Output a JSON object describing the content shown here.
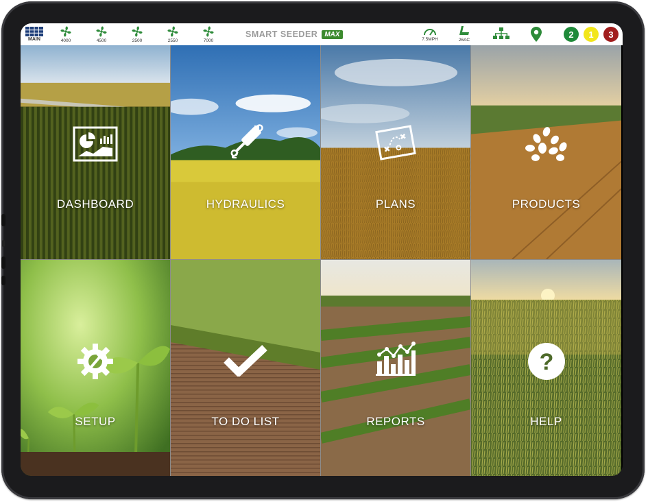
{
  "topbar": {
    "main_label": "MAIN",
    "fans": [
      {
        "icon": "fan-icon",
        "label": "4000"
      },
      {
        "icon": "fan-icon",
        "label": "4500"
      },
      {
        "icon": "fan-icon",
        "label": "2500"
      },
      {
        "icon": "fan-icon",
        "label": "2550"
      },
      {
        "icon": "fan-icon",
        "label": "7000"
      }
    ],
    "brand": "SMART SEEDER",
    "brand_badge": "MAX",
    "speed": "7.5MPH",
    "acres": "26AC",
    "alerts": [
      {
        "count": "2",
        "color": "#1f8a3a"
      },
      {
        "count": "1",
        "color": "#f2e61a"
      },
      {
        "count": "3",
        "color": "#a11d1d"
      }
    ],
    "accent_green": "#2e8b3a"
  },
  "tiles": [
    {
      "label": "DASHBOARD",
      "icon": "dashboard-chart-icon"
    },
    {
      "label": "HYDRAULICS",
      "icon": "hydraulic-cylinder-icon"
    },
    {
      "label": "PLANS",
      "icon": "plan-map-icon"
    },
    {
      "label": "PRODUCTS",
      "icon": "seeds-icon"
    },
    {
      "label": "SETUP",
      "icon": "gear-wrench-icon"
    },
    {
      "label": "TO DO LIST",
      "icon": "checkmark-icon"
    },
    {
      "label": "REPORTS",
      "icon": "bar-chart-icon"
    },
    {
      "label": "HELP",
      "icon": "help-question-icon"
    }
  ]
}
